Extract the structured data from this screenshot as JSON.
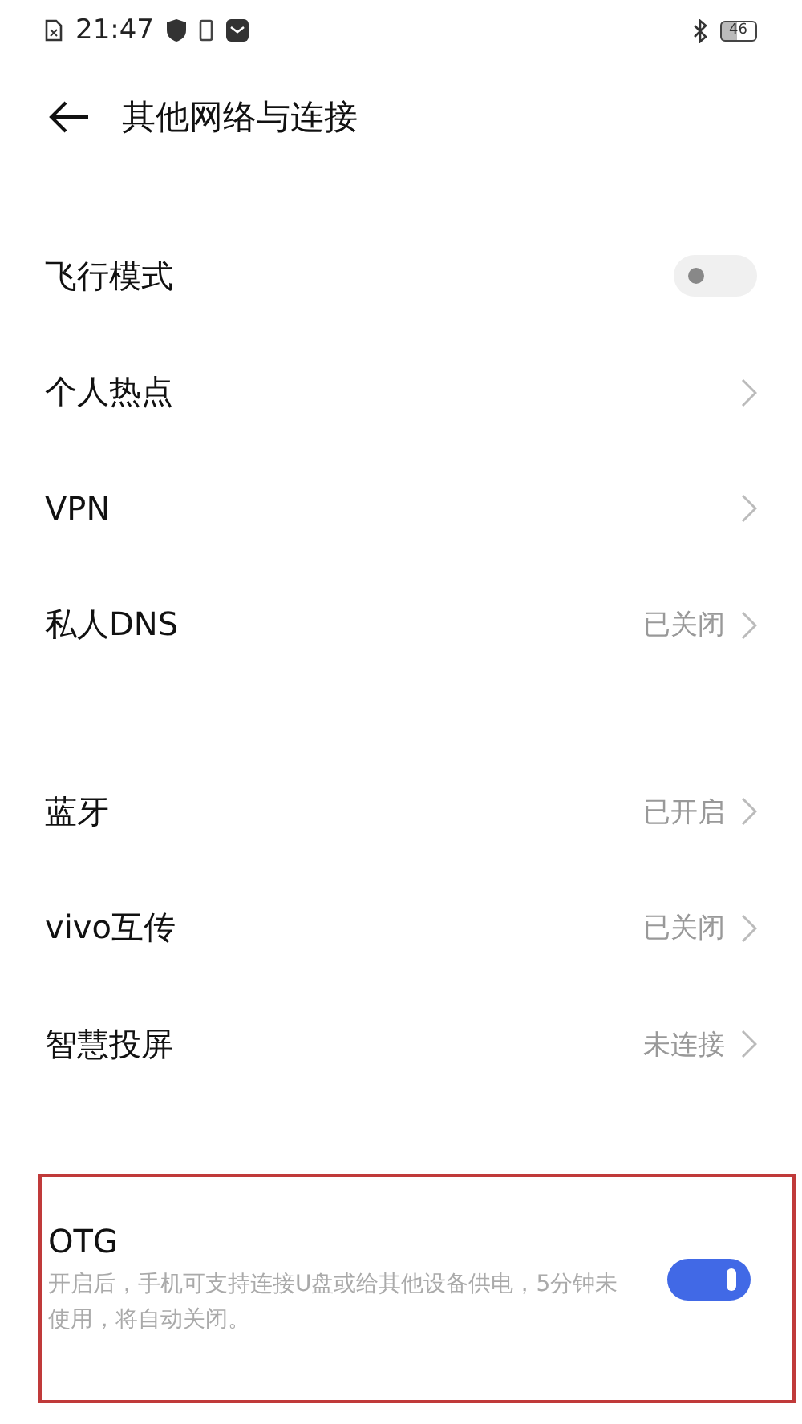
{
  "status_bar": {
    "time": "21:47",
    "battery": "46"
  },
  "header": {
    "title": "其他网络与连接"
  },
  "sections": [
    {
      "rows": [
        {
          "kind": "toggle",
          "label": "飞行模式",
          "on": false
        },
        {
          "kind": "link",
          "label": "个人热点"
        },
        {
          "kind": "link",
          "label": "VPN"
        },
        {
          "kind": "link",
          "label": "私人DNS",
          "value": "已关闭"
        }
      ]
    },
    {
      "rows": [
        {
          "kind": "link",
          "label": "蓝牙",
          "value": "已开启"
        },
        {
          "kind": "link",
          "label": "vivo互传",
          "value": "已关闭"
        },
        {
          "kind": "link",
          "label": "智慧投屏",
          "value": "未连接"
        }
      ]
    }
  ],
  "otg": {
    "label": "OTG",
    "description": "开启后，手机可支持连接U盘或给其他设备供电，5分钟未使用，将自动关闭。",
    "on": true,
    "highlighted": true
  }
}
